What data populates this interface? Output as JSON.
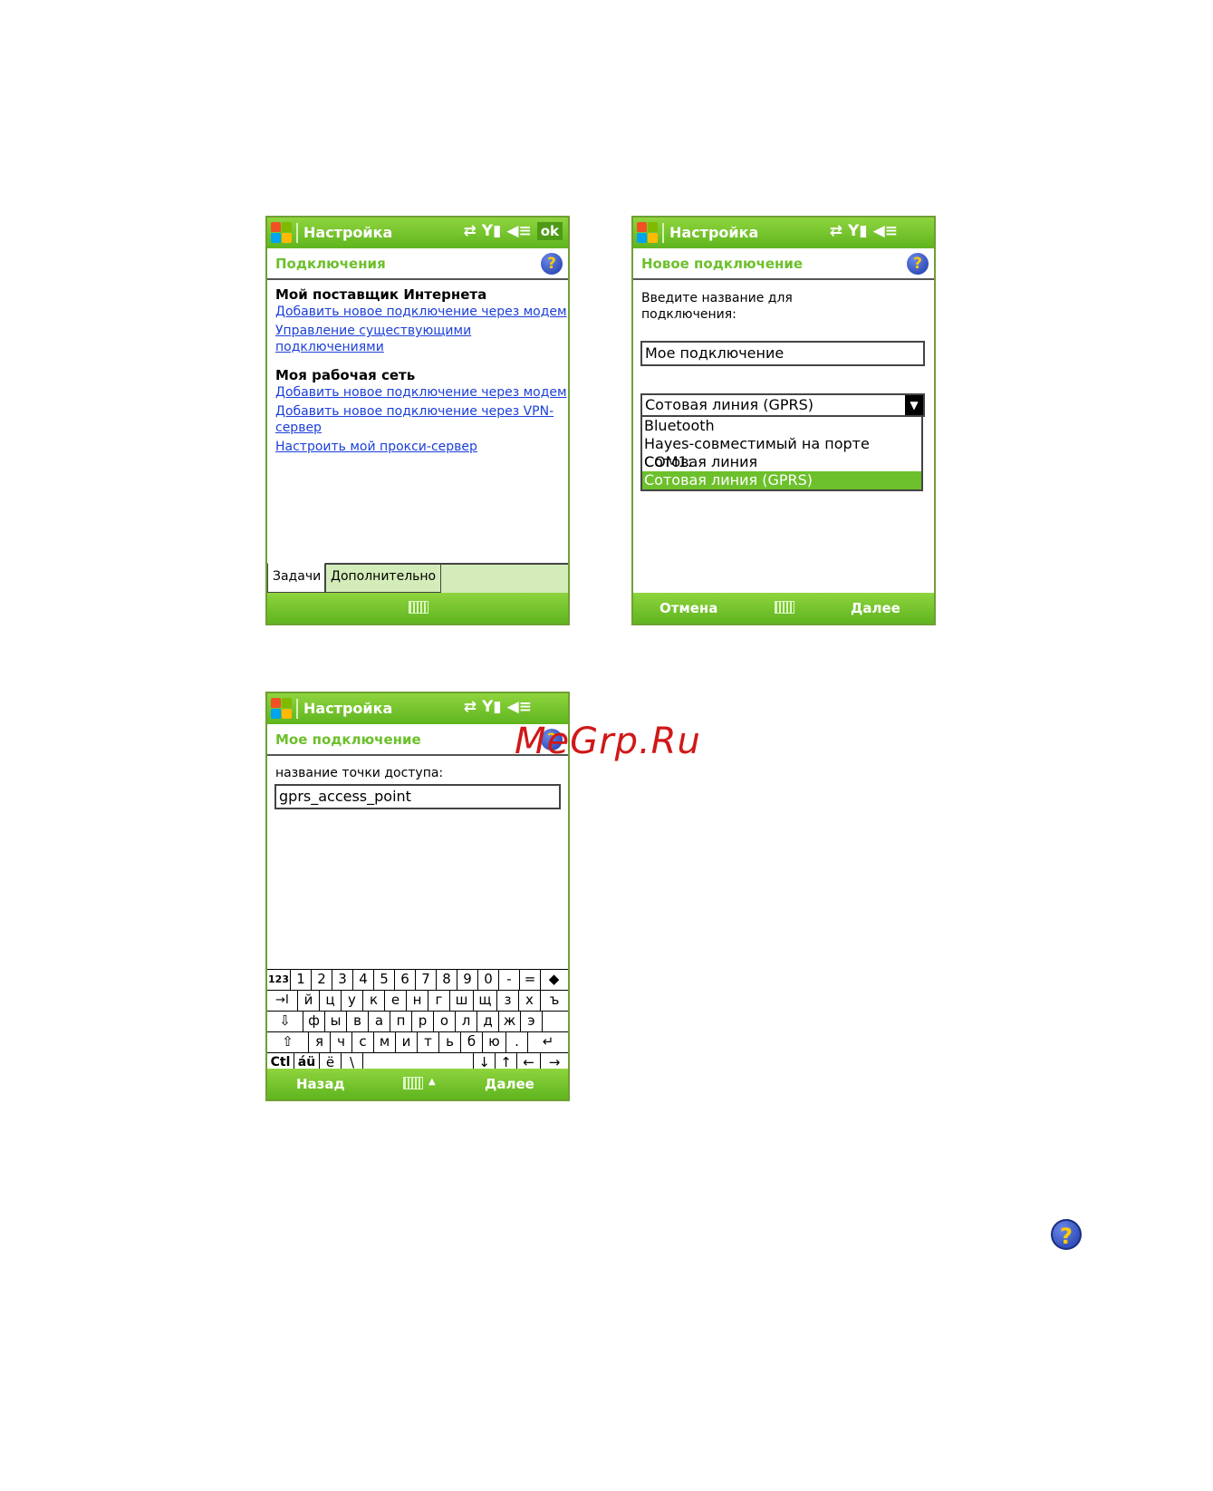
{
  "screen1": {
    "title": "Настройка",
    "ok_label": "ok",
    "subtitle": "Подключения",
    "section1_heading": "Мой поставщик Интернета",
    "section1_links": [
      "Добавить новое подключение через модем",
      "Управление существующими",
      "подключениями"
    ],
    "section2_heading": "Моя рабочая сеть",
    "section2_links": [
      "Добавить новое подключение через модем",
      "Добавить новое подключение через VPN-",
      "сервер",
      "Настроить мой прокси-сервер"
    ],
    "tabs": [
      "Задачи",
      "Дополнительно"
    ]
  },
  "screen2": {
    "title": "Настройка",
    "subtitle": "Новое подключение",
    "prompt_line1": "Введите название для",
    "prompt_line2": "подключения:",
    "name_value": "Мое подключение",
    "modem_selected": "Сотовая линия (GPRS)",
    "modem_options": [
      "Bluetooth",
      "Hayes-совместимый на порте COM1:",
      "Сотовая линия",
      "Сотовая линия (GPRS)"
    ],
    "left_soft": "Отмена",
    "right_soft": "Далее"
  },
  "screen3": {
    "title": "Настройка",
    "subtitle": "Мое подключение",
    "field_label": "название точки доступа:",
    "field_value": "gprs_access_point",
    "left_soft": "Назад",
    "right_soft": "Далее",
    "keyboard": {
      "row1": [
        "123",
        "1",
        "2",
        "3",
        "4",
        "5",
        "6",
        "7",
        "8",
        "9",
        "0",
        "-",
        "=",
        "◆"
      ],
      "row2": [
        "→I",
        "й",
        "ц",
        "у",
        "к",
        "е",
        "н",
        "г",
        "ш",
        "щ",
        "з",
        "х",
        "ъ"
      ],
      "row3": [
        "⇩",
        "ф",
        "ы",
        "в",
        "а",
        "п",
        "р",
        "о",
        "л",
        "д",
        "ж",
        "э"
      ],
      "row4": [
        "⇧",
        "я",
        "ч",
        "с",
        "м",
        "и",
        "т",
        "ь",
        "б",
        "ю",
        ".",
        "↵"
      ],
      "row5": [
        "Ctl",
        "áü",
        "ё",
        "\\",
        "",
        "↓",
        "↑",
        "←",
        "→"
      ]
    }
  },
  "watermark": "MeGrp.Ru",
  "help_glyph": "?",
  "colors": {
    "bar_green": "#6cc02b",
    "link_blue": "#1b3fd9"
  }
}
